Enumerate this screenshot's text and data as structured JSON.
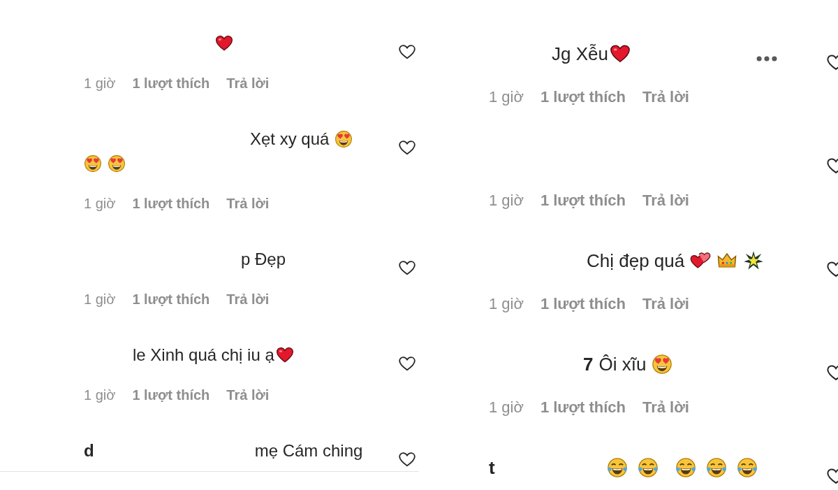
{
  "panels": [
    {
      "comments": [
        {
          "lines": [
            [
              {
                "kind": "heart"
              }
            ]
          ],
          "meta": [
            "1 giờ",
            "1 lượt thích",
            "Trả lời"
          ],
          "more": false
        },
        {
          "lines": [
            [
              {
                "kind": "text",
                "text": "Xẹt xy quá"
              },
              {
                "kind": "heart_eyes"
              }
            ],
            [
              {
                "kind": "heart_eyes"
              },
              {
                "kind": "heart_eyes"
              }
            ]
          ],
          "meta": [
            "1 giờ",
            "1 lượt thích",
            "Trả lời"
          ],
          "more": false
        },
        {
          "lines": [
            [
              {
                "kind": "text",
                "text": "p Đẹp"
              }
            ]
          ],
          "meta": [
            "1 giờ",
            "1 lượt thích",
            "Trả lời"
          ],
          "more": false
        },
        {
          "lines": [
            [
              {
                "kind": "text",
                "text": "le Xinh quá chị iu ạ"
              },
              {
                "kind": "heart"
              }
            ]
          ],
          "meta": [
            "1 giờ",
            "1 lượt thích",
            "Trả lời"
          ],
          "more": false
        },
        {
          "lines": [
            [
              {
                "kind": "username",
                "text": "d"
              },
              {
                "kind": "text",
                "text": "mẹ Cám ching"
              }
            ]
          ],
          "more": false
        }
      ]
    },
    {
      "comments": [
        {
          "lines": [
            [
              {
                "kind": "text",
                "text": "Jg Xễu"
              },
              {
                "kind": "heart"
              }
            ]
          ],
          "meta": [
            "1 giờ",
            "1 lượt thích",
            "Trả lời"
          ],
          "more": true
        },
        {
          "meta": [
            "1 giờ",
            "1 lượt thích",
            "Trả lời"
          ],
          "more": false
        },
        {
          "lines": [
            [
              {
                "kind": "text",
                "text": "Chị đẹp quá"
              },
              {
                "kind": "two_hearts"
              },
              {
                "kind": "crown"
              },
              {
                "kind": "star"
              }
            ]
          ],
          "meta": [
            "1 giờ",
            "1 lượt thích",
            "Trả lời"
          ],
          "more": false
        },
        {
          "lines": [
            [
              {
                "kind": "username",
                "text": "7"
              },
              {
                "kind": "text",
                "text": "Ôi xĩu"
              },
              {
                "kind": "heart_eyes"
              }
            ]
          ],
          "meta": [
            "1 giờ",
            "1 lượt thích",
            "Trả lời"
          ],
          "more": false
        },
        {
          "lines": [
            [
              {
                "kind": "username",
                "text": "t"
              },
              {
                "kind": "joy"
              },
              {
                "kind": "joy"
              },
              {
                "kind": "joy"
              },
              {
                "kind": "joy"
              },
              {
                "kind": "joy"
              }
            ]
          ],
          "more": false
        }
      ]
    }
  ]
}
